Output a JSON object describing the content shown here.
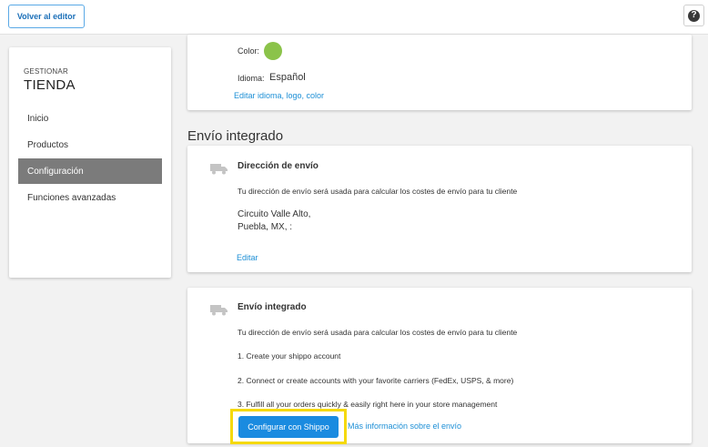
{
  "topbar": {
    "back_label": "Volver al editor",
    "help_icon": "question-circle-icon",
    "help_glyph": "?"
  },
  "sidebar": {
    "subtitle": "GESTIONAR",
    "title": "TIENDA",
    "items": [
      {
        "label": "Inicio",
        "active": false
      },
      {
        "label": "Productos",
        "active": false
      },
      {
        "label": "Configuración",
        "active": true
      },
      {
        "label": "Funciones avanzadas",
        "active": false
      }
    ]
  },
  "store_card": {
    "color_label": "Color:",
    "color_value": "#8bc34a",
    "language_label": "Idioma:",
    "language_value": "Español",
    "edit_link": "Editar idioma, logo, color"
  },
  "section_title": "Envío integrado",
  "address_card": {
    "icon": "truck-icon",
    "title": "Dirección de envío",
    "description": "Tu dirección de envío será usada para calcular los costes de envío para tu cliente",
    "address_line1": "Circuito Valle Alto,",
    "address_line2": "Puebla, MX, :",
    "edit_link": "Editar"
  },
  "integrated_card": {
    "icon": "truck-icon",
    "title": "Envío integrado",
    "description": "Tu dirección de envío será usada para calcular los costes de envío para tu cliente",
    "step1": "1. Create your shippo account",
    "step2": "2. Connect or create accounts with your favorite carriers (FedEx, USPS, & more)",
    "step3": "3. Fulfill all your orders quickly & easily right here in your store management",
    "configure_button": "Configurar con Shippo",
    "more_info_link": "Más información sobre el envío"
  },
  "colors": {
    "accent": "#1a8be0",
    "link": "#1d8fd6",
    "highlight": "#f5d90a",
    "active_nav": "#7b7b7b"
  }
}
